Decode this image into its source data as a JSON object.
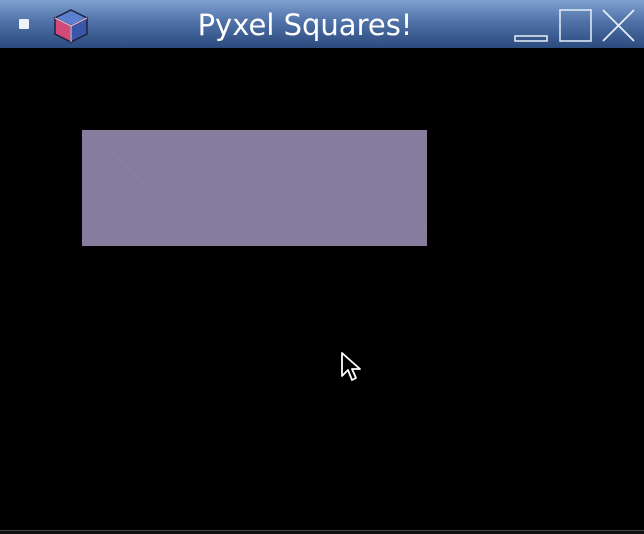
{
  "window": {
    "title": "Pyxel Squares!",
    "colors": {
      "titlebar_top": "#5a7fb3",
      "titlebar_bottom": "#2b4b80",
      "background": "#000000",
      "rectangle": "#857c9e"
    }
  },
  "titlebar": {
    "menu_icon": "window-menu-icon",
    "app_icon": "cube-icon",
    "controls": [
      "minimize-icon",
      "maximize-icon",
      "close-icon"
    ]
  },
  "canvas": {
    "shapes": [
      {
        "type": "rectangle",
        "color": "#857c9e"
      }
    ],
    "cursor": "arrow-cursor"
  }
}
